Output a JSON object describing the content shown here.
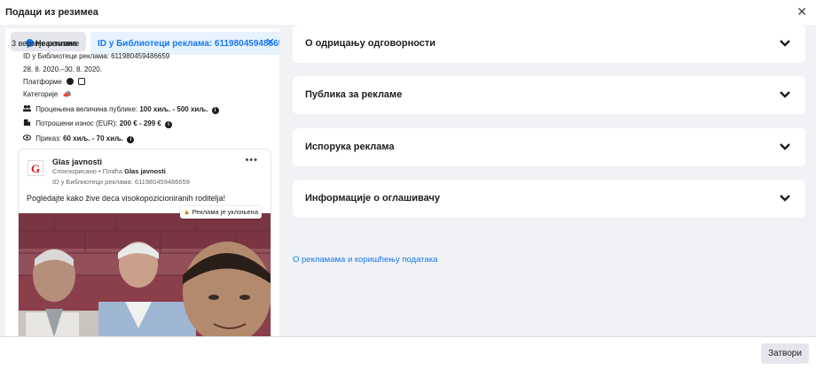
{
  "header": {
    "title": "Подаци из резимеа"
  },
  "left": {
    "status": {
      "active_label": "Неактивна",
      "versions_label": "3 верзије рекламе"
    },
    "id_chip": {
      "label": "ID у Библиотеци реклама: 611980459486659"
    },
    "meta": {
      "library_id": "ID у Библиотеци реклама: 611980459486659",
      "dates": "28. 8. 2020.–30. 8. 2020.",
      "platforms_label": "Платформе",
      "categories_label": "Категорије",
      "audience_label": "Процењена величина публике:",
      "audience_value": "100 хиљ. - 500 хиљ.",
      "spend_label": "Потрошени износ (EUR):",
      "spend_value": "200 € - 299 €",
      "impressions_label": "Приказ:",
      "impressions_value": "60 хиљ. - 70 хиљ."
    },
    "card": {
      "page_name": "Glas javnosti",
      "sponsored_text": "Спонзорисано",
      "paid_by_label": "• Плаћа",
      "paid_by_value": "Glas javnosti",
      "library_id": "ID у Библиотеци реклама: 611980459486659",
      "ad_text": "Pogledajte kako žive deca visokopozicioniranih roditelja!",
      "removed_badge": "Реклама је уклоњена"
    }
  },
  "right": {
    "sections": [
      {
        "title": "О одрицању одговорности"
      },
      {
        "title": "Публика за рекламе"
      },
      {
        "title": "Испорука реклама"
      },
      {
        "title": "Информације о оглашивачу"
      }
    ],
    "link": "О рекламама и коришћењу података"
  },
  "footer": {
    "close_label": "Затвори"
  },
  "colors": {
    "accent": "#1877f2",
    "background": "#f0f2f5",
    "chip_bg": "#e7f3ff"
  }
}
